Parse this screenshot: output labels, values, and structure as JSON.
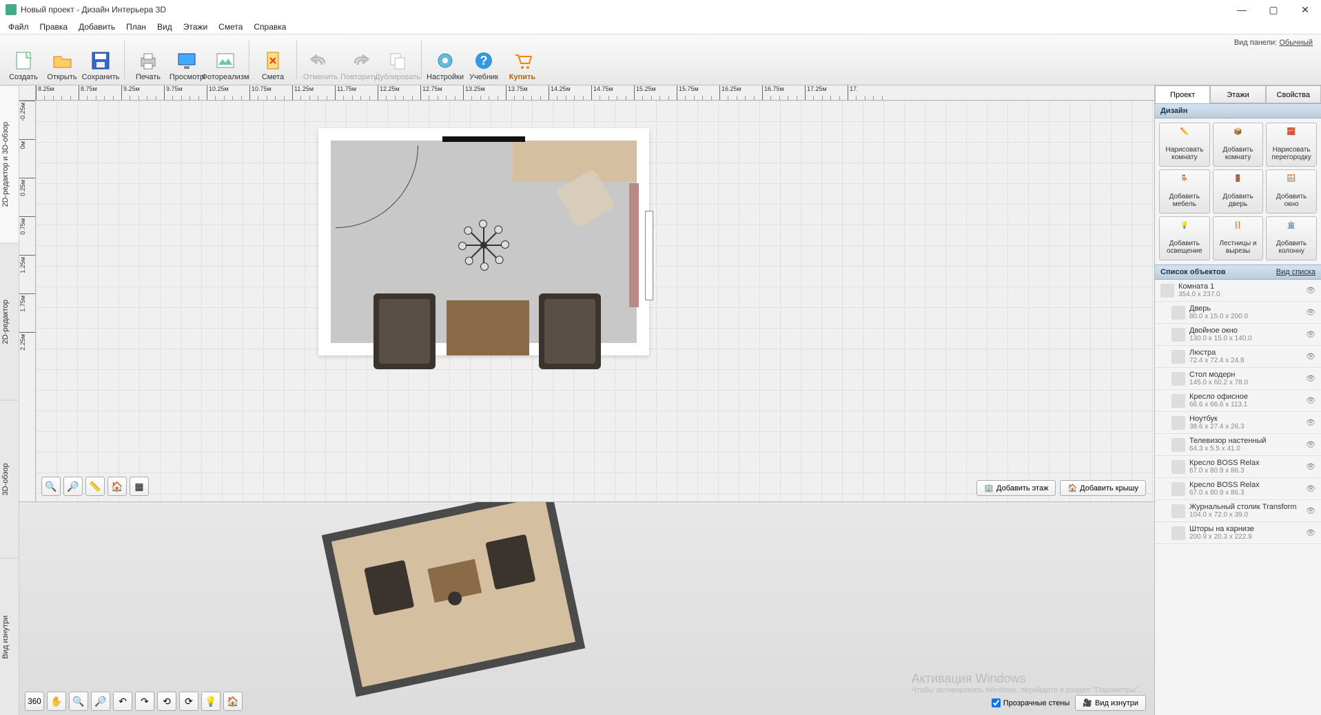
{
  "window": {
    "title": "Новый проект - Дизайн Интерьера 3D"
  },
  "menu": [
    "Файл",
    "Правка",
    "Добавить",
    "План",
    "Вид",
    "Этажи",
    "Смета",
    "Справка"
  ],
  "toolbar": {
    "create": "Создать",
    "open": "Открыть",
    "save": "Сохранить",
    "print": "Печать",
    "preview": "Просмотр",
    "photoreal": "Фотореализм",
    "estimate": "Смета",
    "undo": "Отменить",
    "redo": "Повторить",
    "duplicate": "Дублировать",
    "settings": "Настройки",
    "tutorial": "Учебник",
    "buy": "Купить",
    "panel_mode_label": "Вид панели:",
    "panel_mode_value": "Обычный"
  },
  "left_tabs": [
    "2D-редактор и 3D-обзор",
    "2D-редактор",
    "3D-обзор",
    "Вид изнутри"
  ],
  "ruler_h": [
    "8.25м",
    "8.75м",
    "9.25м",
    "9.75м",
    "10.25м",
    "10.75м",
    "11.25м",
    "11.75м",
    "12.25м",
    "12.75м",
    "13.25м",
    "13.75м",
    "14.25м",
    "14.75м",
    "15.25м",
    "15.75м",
    "16.25м",
    "16.75м",
    "17.25м",
    "17."
  ],
  "ruler_v": [
    "-0.25м",
    "0м",
    "0.25м",
    "0.75м",
    "1.25м",
    "1.75м",
    "2.25м"
  ],
  "canvas2d": {
    "add_floor": "Добавить этаж",
    "add_roof": "Добавить крышу"
  },
  "canvas3d": {
    "transparent_walls": "Прозрачные стены",
    "inside_view": "Вид изнутри",
    "watermark_title": "Активация Windows",
    "watermark_sub": "Чтобы активировать Windows, перейдите в раздел \"Параметры\"."
  },
  "rpanel": {
    "tabs": [
      "Проект",
      "Этажи",
      "Свойства"
    ],
    "design_header": "Дизайн",
    "design_buttons": [
      "Нарисовать комнату",
      "Добавить комнату",
      "Нарисовать перегородку",
      "Добавить мебель",
      "Добавить дверь",
      "Добавить окно",
      "Добавить освещение",
      "Лестницы и вырезы",
      "Добавить колонну"
    ],
    "objects_header": "Список объектов",
    "list_view": "Вид списка",
    "objects": [
      {
        "name": "Комната 1",
        "dim": "354.0 x 237.0",
        "indent": false
      },
      {
        "name": "Дверь",
        "dim": "80.0 x 15.0 x 200.0",
        "indent": true
      },
      {
        "name": "Двойное окно",
        "dim": "130.0 x 15.0 x 140.0",
        "indent": true
      },
      {
        "name": "Люстра",
        "dim": "72.4 x 72.4 x 24.8",
        "indent": true
      },
      {
        "name": "Стол модерн",
        "dim": "145.0 x 60.2 x 78.0",
        "indent": true
      },
      {
        "name": "Кресло офисное",
        "dim": "66.6 x 66.6 x 113.1",
        "indent": true
      },
      {
        "name": "Ноутбук",
        "dim": "38.6 x 27.4 x 26.3",
        "indent": true
      },
      {
        "name": "Телевизор настенный",
        "dim": "64.3 x 5.5 x 41.0",
        "indent": true
      },
      {
        "name": "Кресло BOSS Relax",
        "dim": "67.0 x 80.9 x 86.3",
        "indent": true
      },
      {
        "name": "Кресло BOSS Relax",
        "dim": "67.0 x 80.9 x 86.3",
        "indent": true
      },
      {
        "name": "Журнальный столик Transform",
        "dim": "104.0 x 72.0 x 39.0",
        "indent": true
      },
      {
        "name": "Шторы на карнизе",
        "dim": "200.9 x 20.3 x 222.9",
        "indent": true
      }
    ]
  }
}
